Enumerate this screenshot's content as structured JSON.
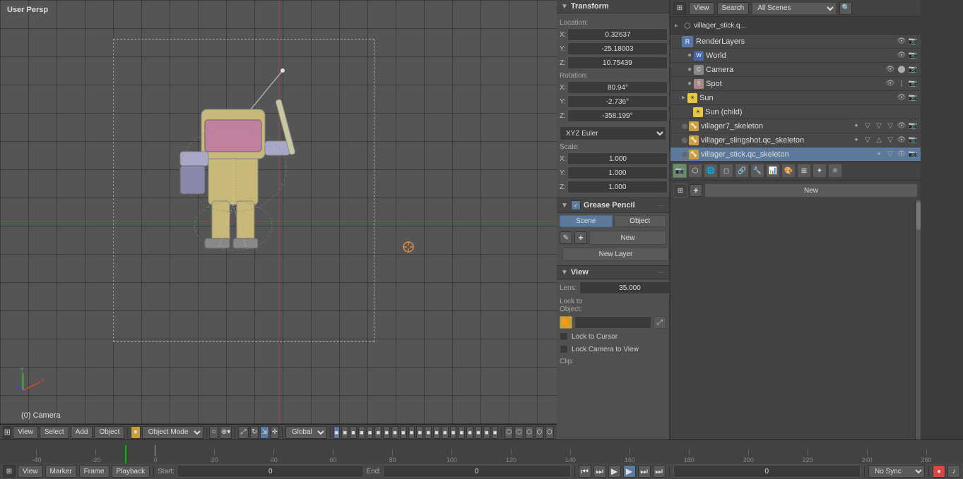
{
  "viewport": {
    "label": "User Persp",
    "camera_label": "(0) Camera"
  },
  "transform": {
    "header": "Transform",
    "location_label": "Location:",
    "rotation_label": "Rotation:",
    "scale_label": "Scale:",
    "x_loc": "0.32637",
    "y_loc": "-25.18003",
    "z_loc": "10.75439",
    "x_rot": "80.94°",
    "y_rot": "-2.736°",
    "z_rot": "-358.199°",
    "x_scale": "1.000",
    "y_scale": "1.000",
    "z_scale": "1.000",
    "euler_mode": "XYZ Euler"
  },
  "grease_pencil": {
    "header": "Grease Pencil",
    "scene_tab": "Scene",
    "object_tab": "Object",
    "new_btn": "New",
    "new_layer_btn": "New Layer"
  },
  "view": {
    "header": "View",
    "lens_label": "Lens:",
    "lens_value": "35.000",
    "lock_to_object_label": "Lock to Object:",
    "lock_to_cursor_label": "Lock to Cursor",
    "lock_camera_label": "Lock Camera to View",
    "clip_label": "Clip:"
  },
  "scene_panel": {
    "scene_select": "All Scenes",
    "header_tabs": [
      "View",
      "Search"
    ],
    "scene_name": "villager_stick.q...",
    "render_layers": "RenderLayers",
    "items": [
      {
        "name": "World",
        "icon": "world",
        "indent": 1
      },
      {
        "name": "Camera",
        "icon": "camera",
        "indent": 1
      },
      {
        "name": "Spot",
        "icon": "spot",
        "indent": 1
      },
      {
        "name": "Sun",
        "icon": "sun",
        "indent": 1
      },
      {
        "name": "Sun (child)",
        "icon": "sun",
        "indent": 2
      },
      {
        "name": "villager7_skeleton",
        "icon": "bone",
        "indent": 1
      },
      {
        "name": "villager_slingshot.qc_skeleton",
        "icon": "bone",
        "indent": 1
      },
      {
        "name": "villager_stick.qc_skeleton",
        "icon": "bone",
        "indent": 1
      }
    ],
    "new_btn": "New"
  },
  "bottom_toolbar": {
    "view_btn": "View",
    "select_btn": "Select",
    "add_btn": "Add",
    "object_btn": "Object",
    "mode_select": "Object Mode",
    "global_select": "Global",
    "sync_select": "No Sync"
  },
  "playback": {
    "view_btn": "View",
    "marker_btn": "Marker",
    "frame_btn": "Frame",
    "playback_btn": "Playback",
    "start_label": "Start:",
    "start_val": "0",
    "end_label": "End:",
    "end_val": "0",
    "current_frame": "0",
    "sync_mode": "No Sync"
  },
  "timeline_marks": [
    "-40",
    "-20",
    "0",
    "20",
    "40",
    "60",
    "80",
    "100",
    "120",
    "140",
    "160",
    "180",
    "200",
    "220",
    "240",
    "260"
  ]
}
